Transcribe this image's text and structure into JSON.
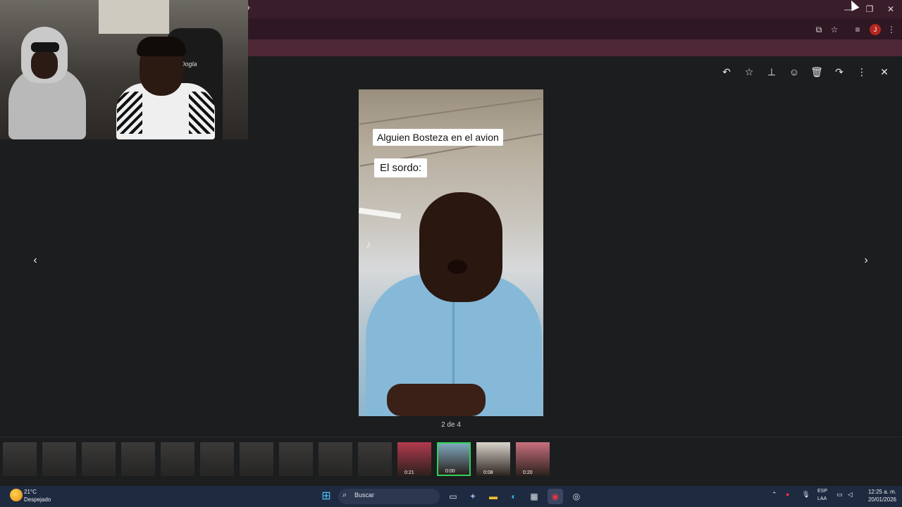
{
  "window_controls": {
    "minimize": "—",
    "restore": "❐",
    "close": "✕"
  },
  "browser": {
    "new_tab_glyph": "+",
    "profile_initial": "J"
  },
  "webcam": {
    "chair_brand": "Dogla"
  },
  "viewer": {
    "toolbar_icons": [
      "reply-icon",
      "star-icon",
      "pin-icon",
      "emoji-icon",
      "trash-icon",
      "forward-icon",
      "more-icon",
      "close-icon"
    ],
    "toolbar_glyphs": {
      "reply": "↶",
      "star": "☆",
      "pin": "⊥",
      "emoji": "☺",
      "trash": "🗑",
      "forward": "↷",
      "more": "⋮",
      "close": "✕"
    },
    "caption_top": "Alguien Bosteza en el avion",
    "caption_bottom": "El sordo:",
    "counter": "2 de 4",
    "prev_arrow": "‹",
    "next_arrow": "›"
  },
  "filmstrip": {
    "thumbnails": [
      {
        "duration": "",
        "dimmed": true
      },
      {
        "duration": "",
        "dimmed": true
      },
      {
        "duration": "",
        "dimmed": true
      },
      {
        "duration": "",
        "dimmed": true
      },
      {
        "duration": "",
        "dimmed": true
      },
      {
        "duration": "",
        "dimmed": true
      },
      {
        "duration": "",
        "dimmed": true
      },
      {
        "duration": "",
        "dimmed": true
      },
      {
        "duration": "",
        "dimmed": true
      },
      {
        "duration": "",
        "dimmed": true
      },
      {
        "duration": "0:21",
        "dimmed": false,
        "color": "#b23a4e"
      },
      {
        "duration": "0:00",
        "dimmed": false,
        "color": "#7fa7bd",
        "active": true
      },
      {
        "duration": "0:08",
        "dimmed": false,
        "color": "#d9d4cc"
      },
      {
        "duration": "0:20",
        "dimmed": false,
        "color": "#c8707e"
      }
    ]
  },
  "taskbar": {
    "weather_temp": "21°C",
    "weather_desc": "Despejado",
    "search_placeholder": "Buscar",
    "lang_top": "ESP",
    "lang_bottom": "LAA",
    "time": "12:25 a. m.",
    "date": "20/01/2026"
  },
  "colors": {
    "accent_active": "#2fd35a",
    "chrome_bg": "#3a1d2a",
    "viewer_bg": "#1b1d1e",
    "taskbar_bg": "#1e2a3f"
  }
}
